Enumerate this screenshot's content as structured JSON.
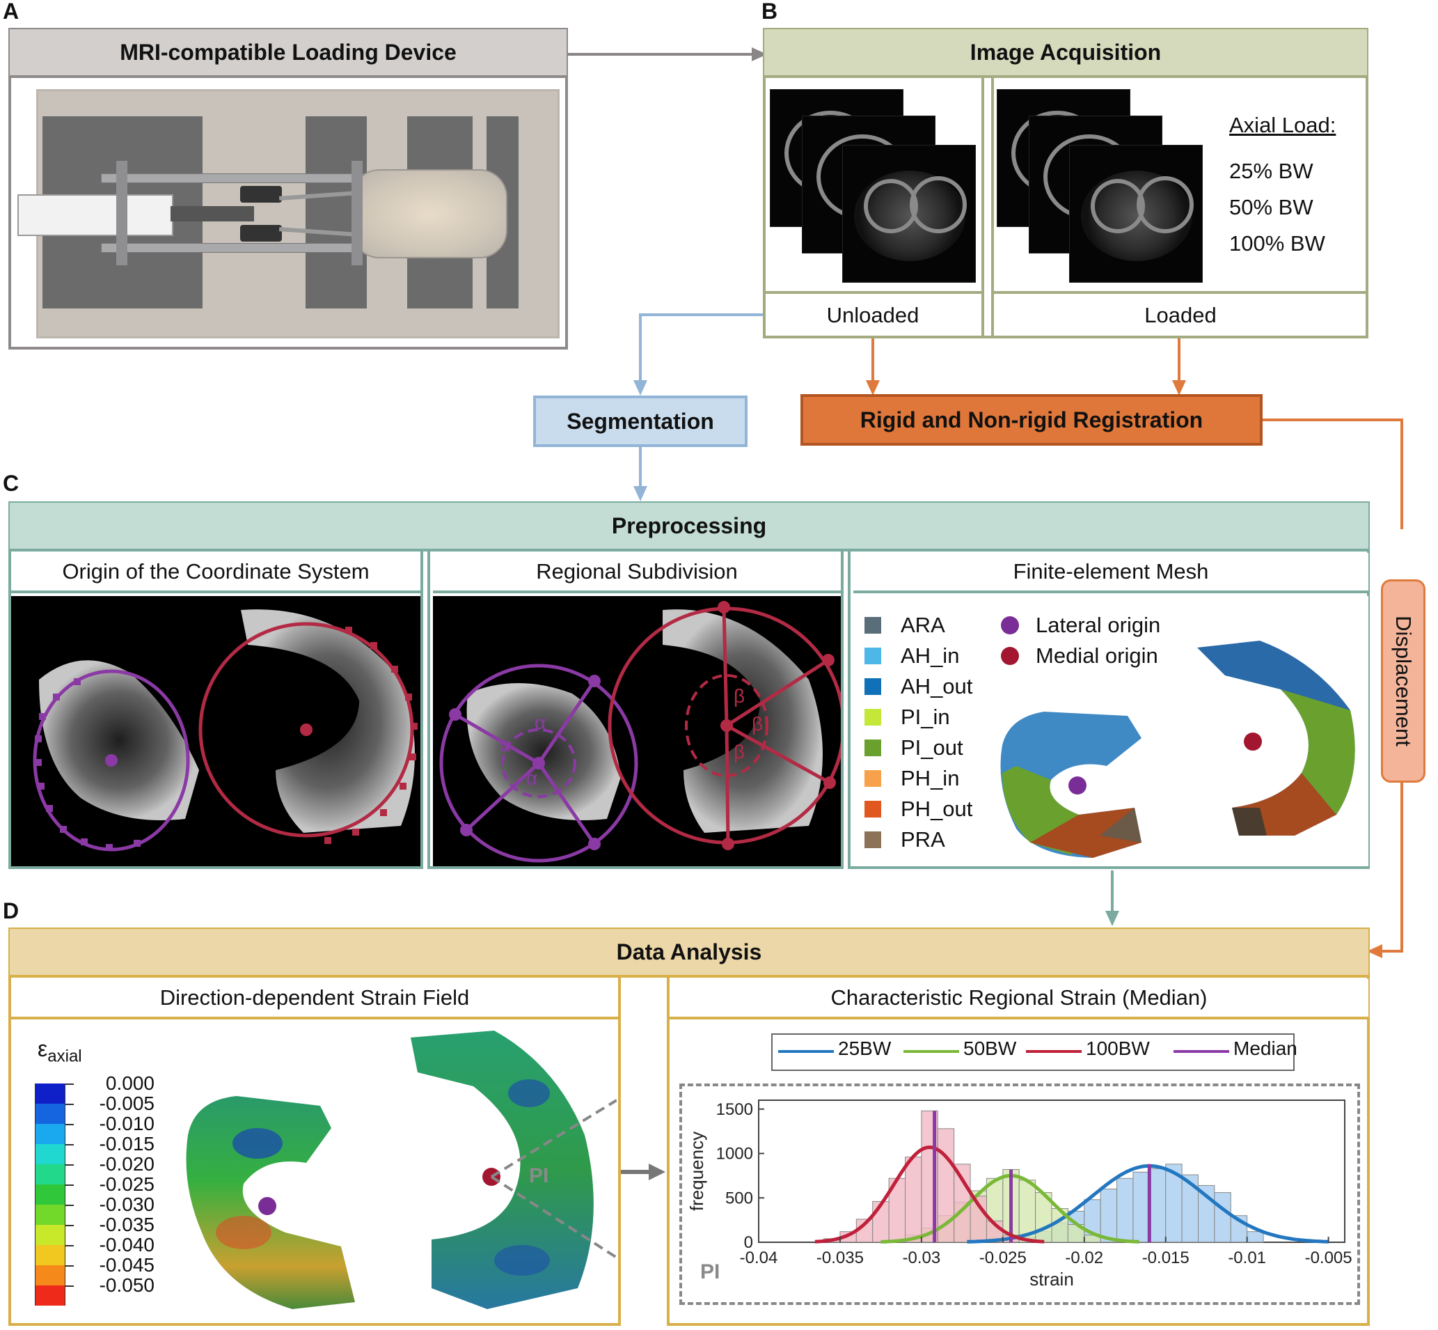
{
  "panels": {
    "a": {
      "letter": "A",
      "title": "MRI-compatible Loading Device"
    },
    "b": {
      "letter": "B",
      "title": "Image Acquisition",
      "unloaded": "Unloaded",
      "loaded": "Loaded",
      "axial_load_title": "Axial Load:",
      "loads": [
        "25% BW",
        "50% BW",
        "100% BW"
      ]
    },
    "segmentation": "Segmentation",
    "registration": "Rigid and Non-rigid Registration",
    "displacement": "Displacement",
    "c": {
      "letter": "C",
      "title": "Preprocessing",
      "origin": "Origin of the Coordinate System",
      "regional": "Regional Subdivision",
      "mesh": "Finite-element Mesh",
      "alpha": "α",
      "beta": "β",
      "legend": [
        {
          "label": "ARA",
          "color": "#5a6e7a"
        },
        {
          "label": "AH_in",
          "color": "#4db8e8"
        },
        {
          "label": "AH_out",
          "color": "#1071b8"
        },
        {
          "label": "PI_in",
          "color": "#c4e83a"
        },
        {
          "label": "PI_out",
          "color": "#6aa12e"
        },
        {
          "label": "PH_in",
          "color": "#f7a24b"
        },
        {
          "label": "PH_out",
          "color": "#e0571f"
        },
        {
          "label": "PRA",
          "color": "#8c7257"
        }
      ],
      "origins": [
        {
          "label": "Lateral origin",
          "color": "#7a2d96"
        },
        {
          "label": "Medial origin",
          "color": "#a3162f"
        }
      ]
    },
    "d": {
      "letter": "D",
      "title": "Data Analysis",
      "strain_field": "Direction-dependent Strain Field",
      "regional_strain": "Characteristic Regional Strain (Median)",
      "eps_symbol": "ε",
      "eps_sub": "axial",
      "colorbar_ticks": [
        "0.000",
        "-0.005",
        "-0.010",
        "-0.015",
        "-0.020",
        "-0.025",
        "-0.030",
        "-0.035",
        "-0.040",
        "-0.045",
        "-0.050"
      ],
      "colorbar_colors": [
        "#1020c8",
        "#1565e0",
        "#1aa8ee",
        "#20d8d0",
        "#22d88a",
        "#30c83a",
        "#72d82a",
        "#c8e82a",
        "#f0c820",
        "#f58a1a",
        "#ee2a1a"
      ],
      "pi_label": "PI"
    }
  },
  "chart_data": {
    "type": "histogram",
    "xlabel": "strain",
    "ylabel": "frequency",
    "xlim": [
      -0.04,
      -0.004
    ],
    "ylim": [
      0,
      1600
    ],
    "xticks": [
      -0.04,
      -0.035,
      -0.03,
      -0.025,
      -0.02,
      -0.015,
      -0.01,
      -0.005
    ],
    "xtick_labels": [
      "-0.04",
      "-0.035",
      "-0.03",
      "-0.025",
      "-0.02",
      "-0.015",
      "-0.01",
      "-0.005"
    ],
    "yticks": [
      0,
      500,
      1000,
      1500
    ],
    "annotation": "PI",
    "legend": [
      "25BW",
      "50BW",
      "100BW",
      "Median"
    ],
    "series": [
      {
        "name": "25BW",
        "color": "#2277c0",
        "fill": "#a8cdef",
        "mean": -0.016,
        "sd": 0.0035,
        "peak": 860,
        "median": -0.016,
        "bins_x": [
          -0.0235,
          -0.0225,
          -0.0215,
          -0.0205,
          -0.0195,
          -0.0185,
          -0.0175,
          -0.0165,
          -0.0155,
          -0.0145,
          -0.0135,
          -0.0125,
          -0.0115,
          -0.0105,
          -0.0095
        ],
        "bins_y": [
          60,
          120,
          220,
          350,
          480,
          600,
          720,
          790,
          830,
          880,
          760,
          640,
          560,
          300,
          120
        ]
      },
      {
        "name": "50BW",
        "color": "#7ab838",
        "fill": "#d6e8b0",
        "mean": -0.0245,
        "sd": 0.0025,
        "peak": 750,
        "median": -0.0245,
        "bins_x": [
          -0.0305,
          -0.0295,
          -0.0285,
          -0.0275,
          -0.0265,
          -0.0255,
          -0.0245,
          -0.0235,
          -0.0225,
          -0.0215,
          -0.0205,
          -0.0195
        ],
        "bins_y": [
          80,
          160,
          300,
          450,
          580,
          720,
          820,
          700,
          560,
          380,
          200,
          80
        ]
      },
      {
        "name": "100BW",
        "color": "#c0203a",
        "fill": "#f0b8c4",
        "mean": -0.0295,
        "sd": 0.0022,
        "peak": 1070,
        "median": -0.0292,
        "bins_x": [
          -0.0355,
          -0.0345,
          -0.0335,
          -0.0325,
          -0.0315,
          -0.0305,
          -0.0295,
          -0.0285,
          -0.0275,
          -0.0265,
          -0.0255,
          -0.0245
        ],
        "bins_y": [
          40,
          120,
          260,
          460,
          720,
          960,
          1480,
          1280,
          880,
          520,
          240,
          80
        ]
      }
    ]
  }
}
